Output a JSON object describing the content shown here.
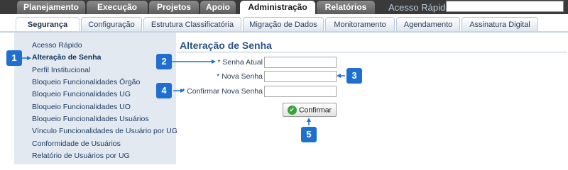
{
  "top_nav": {
    "tabs": [
      "Planejamento",
      "Execução",
      "Projetos",
      "Apoio",
      "Administração",
      "Relatórios"
    ],
    "active_tab": "Administração",
    "quick_access_label": "Acesso Rápido",
    "quick_access_value": ""
  },
  "sub_nav": {
    "tabs": [
      "Segurança",
      "Configuração",
      "Estrutura Classificatória",
      "Migração de Dados",
      "Monitoramento",
      "Agendamento",
      "Assinatura Digital"
    ],
    "active_tab": "Segurança"
  },
  "sidebar": {
    "items": [
      "Acesso Rápido",
      "Alteração de Senha",
      "Perfil Institucional",
      "Bloqueio Funcionalidades Órgão",
      "Bloqueio Funcionalidades UG",
      "Bloqueio Funcionalidades UO",
      "Bloqueio Funcionalidades Usuários",
      "Vínculo Funcionalidades de Usuário por UG",
      "Conformidade de Usuários",
      "Relatório de Usuários por UG"
    ],
    "active_item": "Alteração de Senha"
  },
  "form": {
    "title": "Alteração de Senha",
    "fields": [
      {
        "label": "* Senha Atual",
        "value": ""
      },
      {
        "label": "* Nova Senha",
        "value": ""
      },
      {
        "label": "* Confirmar Nova Senha",
        "value": ""
      }
    ],
    "confirm_label": "Confirmar"
  },
  "callouts": [
    "1",
    "2",
    "3",
    "4",
    "5"
  ],
  "colors": {
    "callout": "#1f6fd1",
    "sidebar_bg": "#e2e9f1",
    "title": "#2a5387",
    "top_bar": "#3a3a3a"
  }
}
